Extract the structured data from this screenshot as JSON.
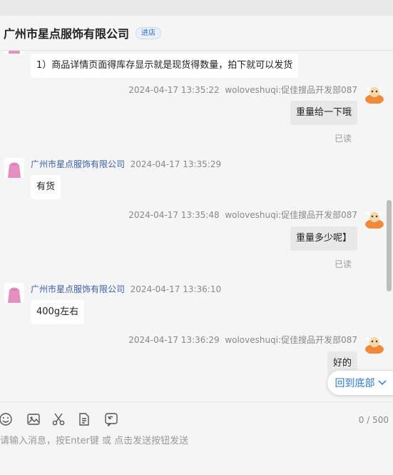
{
  "header": {
    "title": "广州市星点服饰有限公司",
    "badge": "进店"
  },
  "messages": [
    {
      "text": "1）商品详情页面得库存显示就是现货得数量，拍下就可以发货"
    },
    {
      "time": "2024-04-17 13:35:22",
      "sender": "woloveshuqi:促佳搜品开发部087",
      "text": "重量给一下哦",
      "status": "已读"
    },
    {
      "sender": "广州市星点服饰有限公司",
      "time": "2024-04-17 13:35:29",
      "text": "有货"
    },
    {
      "time": "2024-04-17 13:35:48",
      "sender": "woloveshuqi:促佳搜品开发部087",
      "text": "重量多少呢】",
      "status": "已读"
    },
    {
      "sender": "广州市星点服饰有限公司",
      "time": "2024-04-17 13:36:10",
      "text": "400g左右"
    },
    {
      "time": "2024-04-17 13:36:29",
      "sender": "woloveshuqi:促佳搜品开发部087",
      "text": "好的"
    }
  ],
  "back_to_bottom": "回到底部",
  "toolbar": {
    "icons": [
      "smile-icon",
      "image-icon",
      "scissors-icon",
      "file-icon",
      "history-icon"
    ],
    "counter": "0 / 500"
  },
  "input": {
    "placeholder": "请输入消息，按Enter键 或 点击发送按钮发送"
  }
}
